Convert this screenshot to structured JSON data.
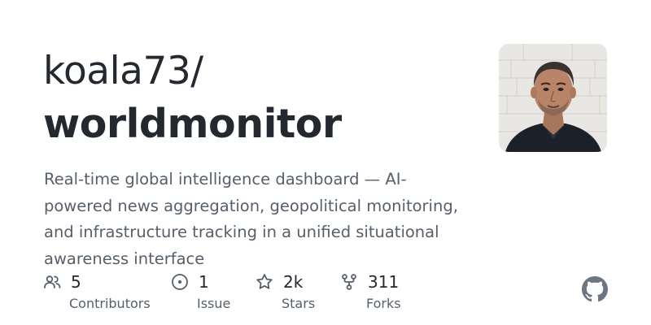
{
  "repo": {
    "owner": "koala73/",
    "name": "worldmonitor",
    "description": "Real-time global intelligence dashboard — AI-powered news aggregation, geopolitical monitoring, and infrastructure tracking in a unified situational awareness interface"
  },
  "stats": {
    "contributors": {
      "value": "5",
      "label": "Contributors"
    },
    "issues": {
      "value": "1",
      "label": "Issue"
    },
    "stars": {
      "value": "2k",
      "label": "Stars"
    },
    "forks": {
      "value": "311",
      "label": "Forks"
    }
  },
  "colors": {
    "text_primary": "#24292f",
    "text_secondary": "#57606a",
    "background": "#ffffff"
  },
  "icons": {
    "contributors": "people-icon",
    "issues": "issue-opened-icon",
    "stars": "star-icon",
    "forks": "repo-forked-icon",
    "brand": "github-mark-icon"
  }
}
